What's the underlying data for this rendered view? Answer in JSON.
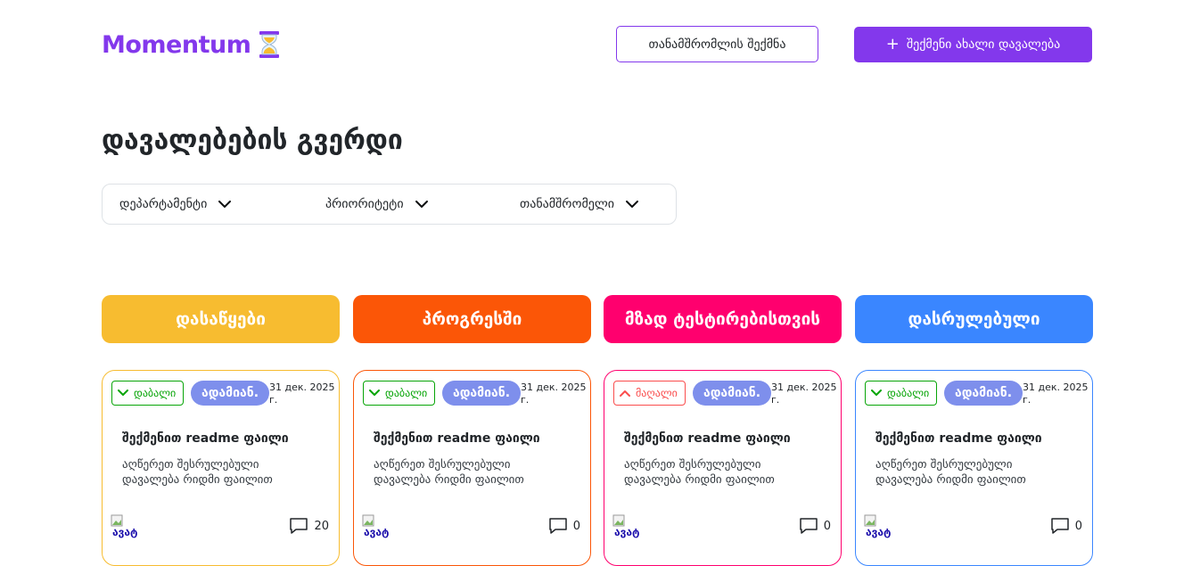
{
  "header": {
    "logo_text": "Momentum",
    "logo_icon": "hourglass-icon",
    "create_employee_label": "თანამშრომლის შექმნა",
    "create_task_label": "შექმენი ახალი დავალება",
    "brand_color": "#8338EC"
  },
  "page": {
    "title": "დავალებების გვერდი"
  },
  "filters": [
    {
      "label": "დეპარტამენტი"
    },
    {
      "label": "პრიორიტეტი"
    },
    {
      "label": "თანამშრომელი"
    }
  ],
  "columns": [
    {
      "title": "დასაწყები",
      "color": "#F7BC30"
    },
    {
      "title": "პროგრესში",
      "color": "#FB5607"
    },
    {
      "title": "მზად ტესტირებისთვის",
      "color": "#FF006E"
    },
    {
      "title": "დასრულებული",
      "color": "#3A86FF"
    }
  ],
  "cards": [
    {
      "priority": "დაბალი",
      "priority_color": "#08A508",
      "priority_icon": "chevron-down-icon",
      "department": "ადამიან.",
      "due_date": "31 дек. 2025 г.",
      "title": "შექმენით readme ფაილი",
      "description": "აღწერეთ შესრულებული დავალება რიდმი ფაილით",
      "avatar_alt": "ავატ",
      "comments": "20"
    },
    {
      "priority": "დაბალი",
      "priority_color": "#08A508",
      "priority_icon": "chevron-down-icon",
      "department": "ადამიან.",
      "due_date": "31 дек. 2025 г.",
      "title": "შექმენით readme ფაილი",
      "description": "აღწერეთ შესრულებული დავალება რიდმი ფაილით",
      "avatar_alt": "ავატ",
      "comments": "0"
    },
    {
      "priority": "მაღალი",
      "priority_color": "#FA4D4D",
      "priority_icon": "chevron-up-icon",
      "department": "ადამიან.",
      "due_date": "31 дек. 2025 г.",
      "title": "შექმენით readme ფაილი",
      "description": "აღწერეთ შესრულებული დავალება რიდმი ფაილით",
      "avatar_alt": "ავატ",
      "comments": "0"
    },
    {
      "priority": "დაბალი",
      "priority_color": "#08A508",
      "priority_icon": "chevron-down-icon",
      "department": "ადამიან.",
      "due_date": "31 дек. 2025 г.",
      "title": "შექმენით readme ფაილი",
      "description": "აღწერეთ შესრულებული დავალება რიდმი ფაილით",
      "avatar_alt": "ავატ",
      "comments": "0"
    }
  ]
}
